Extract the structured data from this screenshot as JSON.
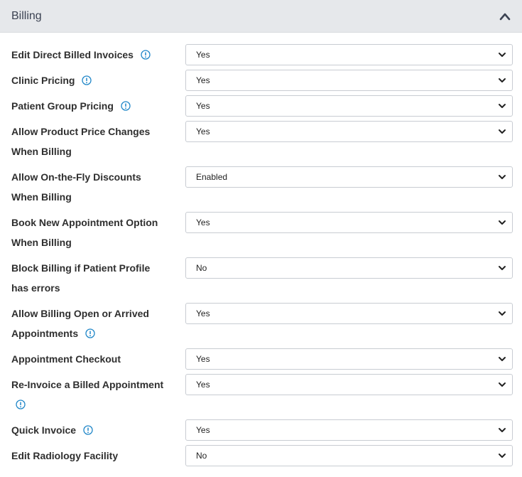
{
  "header": {
    "title": "Billing"
  },
  "settings": [
    {
      "label": "Edit Direct Billed Invoices",
      "value": "Yes"
    },
    {
      "label": "Clinic Pricing",
      "value": "Yes"
    },
    {
      "label": "Patient Group Pricing",
      "value": "Yes"
    },
    {
      "label": "Allow Product Price Changes When Billing",
      "value": "Yes"
    },
    {
      "label": "Allow On-the-Fly Discounts When Billing",
      "value": "Enabled"
    },
    {
      "label": "Book New Appointment Option When Billing",
      "value": "Yes"
    },
    {
      "label": "Block Billing if Patient Profile has errors",
      "value": "No"
    },
    {
      "label": "Allow Billing Open or Arrived Appointments",
      "value": "Yes"
    },
    {
      "label": "Appointment Checkout",
      "value": "Yes"
    },
    {
      "label": "Re-Invoice a Billed Appointment",
      "value": "Yes"
    },
    {
      "label": "Quick Invoice",
      "value": "Yes"
    },
    {
      "label": "Edit Radiology Facility",
      "value": "No"
    }
  ],
  "colors": {
    "header_bg": "#e6e8eb",
    "info_icon": "#1f86c8",
    "border": "#c8ccd2"
  },
  "icons": {
    "collapse": "chevron-up-icon",
    "info": "info-icon",
    "dropdown": "chevron-down-icon"
  }
}
